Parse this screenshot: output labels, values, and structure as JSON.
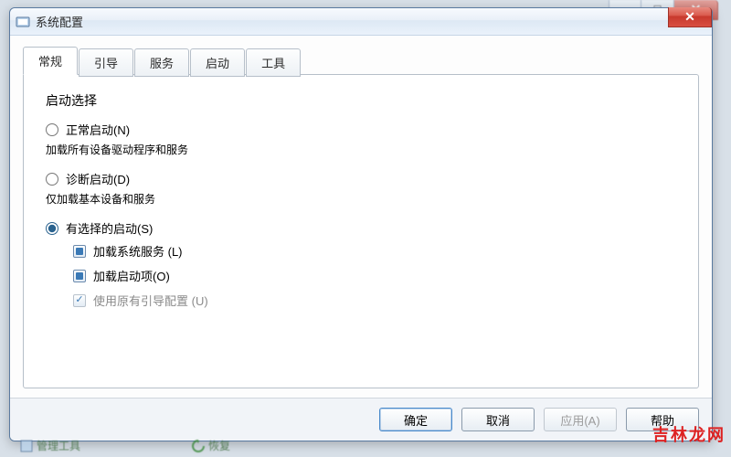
{
  "window": {
    "title": "系统配置",
    "icon_name": "msconfig-icon"
  },
  "tabs": [
    {
      "label": "常规"
    },
    {
      "label": "引导"
    },
    {
      "label": "服务"
    },
    {
      "label": "启动"
    },
    {
      "label": "工具"
    }
  ],
  "general": {
    "group_title": "启动选择",
    "normal": {
      "label": "正常启动(N)",
      "desc": "加载所有设备驱动程序和服务"
    },
    "diagnostic": {
      "label": "诊断启动(D)",
      "desc": "仅加载基本设备和服务"
    },
    "selective": {
      "label": "有选择的启动(S)",
      "check_sys": "加载系统服务 (L)",
      "check_startup": "加载启动项(O)",
      "check_boot": "使用原有引导配置 (U)"
    }
  },
  "buttons": {
    "ok": "确定",
    "cancel": "取消",
    "apply": "应用(A)",
    "help": "帮助"
  },
  "background": {
    "mgmt": "管理工具",
    "restore": "恢复"
  },
  "watermark": "吉林龙网"
}
